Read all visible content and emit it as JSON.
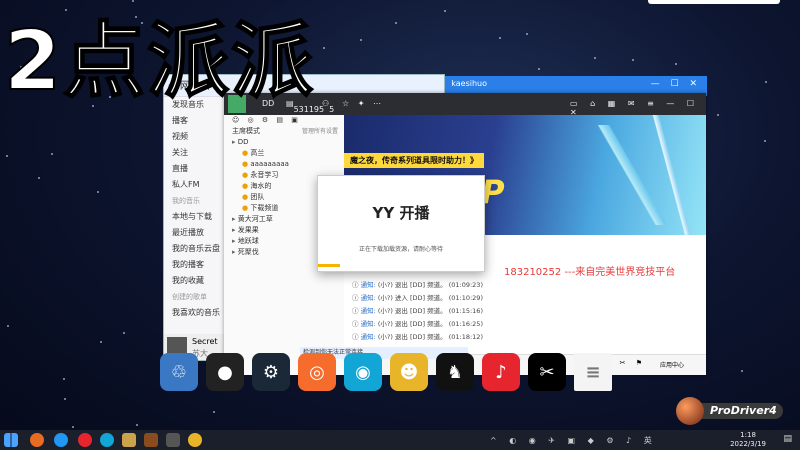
{
  "overlay_title": "2点派派",
  "netease": {
    "window_title": "网易云",
    "sidebar": [
      {
        "label": "发现音乐",
        "type": "item"
      },
      {
        "label": "播客",
        "type": "item"
      },
      {
        "label": "视频",
        "type": "item"
      },
      {
        "label": "关注",
        "type": "item"
      },
      {
        "label": "直播",
        "type": "item"
      },
      {
        "label": "私人FM",
        "type": "item"
      },
      {
        "label": "我的音乐",
        "type": "section"
      },
      {
        "label": "本地与下载",
        "type": "item"
      },
      {
        "label": "最近播放",
        "type": "item"
      },
      {
        "label": "我的音乐云盘",
        "type": "item"
      },
      {
        "label": "我的播客",
        "type": "item"
      },
      {
        "label": "我的收藏",
        "type": "item"
      },
      {
        "label": "创建的歌单",
        "type": "section"
      },
      {
        "label": "我喜欢的音乐",
        "type": "item"
      }
    ],
    "now_playing": {
      "title": "Secret",
      "artist": "苏大"
    }
  },
  "top_bar": {
    "account": "kaesihuo"
  },
  "yy": {
    "channel_name": "DD",
    "channel_id": "531195",
    "online_count": "5",
    "left_panel": {
      "mode": "主席模式",
      "manage": "管理所有设置",
      "rows": [
        {
          "label": "DD",
          "indent": 0
        },
        {
          "label": "高兰",
          "indent": 1
        },
        {
          "label": "aaaaaaaaa",
          "indent": 1
        },
        {
          "label": "永音学习",
          "indent": 1
        },
        {
          "label": "海水的",
          "indent": 1
        },
        {
          "label": "团队",
          "indent": 1
        },
        {
          "label": "下载频道",
          "indent": 1
        },
        {
          "label": "黄大河工草",
          "indent": 0
        },
        {
          "label": "发果果",
          "indent": 0
        },
        {
          "label": "地跃球",
          "indent": 0
        },
        {
          "label": "死聚伐",
          "indent": 0
        }
      ]
    },
    "banner": {
      "text": "魔之夜，传奇系列道具限时助力！》",
      "big": "EOP"
    },
    "promo": "183210252 ---来自完美世界竞技平台",
    "messages": [
      {
        "tag": "通知:",
        "text": "(小?) 退出 [DD] 频道。",
        "time": "(01:09:23)"
      },
      {
        "tag": "通知:",
        "text": "(小?) 进入 [DD] 频道。",
        "time": "(01:10:29)"
      },
      {
        "tag": "通知:",
        "text": "(小?) 退出 [DD] 频道。",
        "time": "(01:15:16)"
      },
      {
        "tag": "通知:",
        "text": "(小?) 退出 [DD] 频道。",
        "time": "(01:16:25)"
      },
      {
        "tag": "通知:",
        "text": "(小?) 退出 [DD] 频道。",
        "time": "(01:18:12)"
      }
    ],
    "chatbar_right": "应用中心"
  },
  "popup": {
    "brand": "YY 开播",
    "status": "正在下载加载资源，请耐心等待"
  },
  "notice_bar": "检测到你无法正常连接...",
  "dock_icons": [
    {
      "name": "recycle-bin-icon",
      "color": "#3b78c4",
      "glyph": "♲"
    },
    {
      "name": "obs-icon",
      "color": "#222222",
      "glyph": "●"
    },
    {
      "name": "steam-icon",
      "color": "#1b2838",
      "glyph": "⚙"
    },
    {
      "name": "origin-icon",
      "color": "#f56c2d",
      "glyph": "◎"
    },
    {
      "name": "netease-uu-icon",
      "color": "#12a6d6",
      "glyph": "◉"
    },
    {
      "name": "yy-mascot-icon",
      "color": "#e8b52a",
      "glyph": "☻"
    },
    {
      "name": "qq-icon",
      "color": "#111111",
      "glyph": "♞"
    },
    {
      "name": "netease-music-icon",
      "color": "#e6252f",
      "glyph": "♪"
    },
    {
      "name": "capcut-icon",
      "color": "#000000",
      "glyph": "✂"
    },
    {
      "name": "document-icon",
      "color": "#f4f4f4",
      "glyph": "≡"
    }
  ],
  "watermark": "ProDriver4",
  "taskbar": {
    "time": "1:18",
    "date": "2022/3/19"
  }
}
